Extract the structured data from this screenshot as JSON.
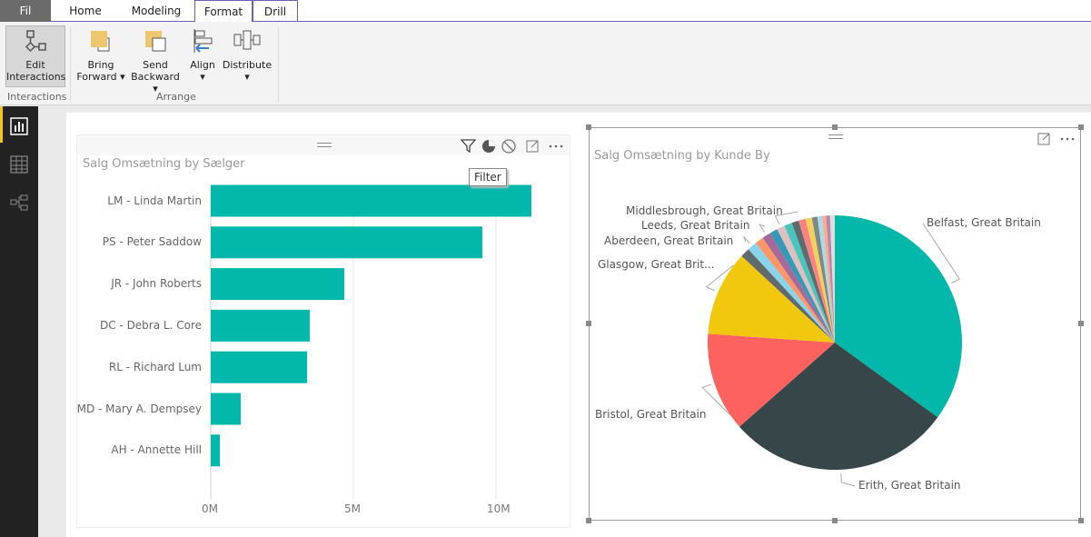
{
  "tabs": [
    {
      "label": "Fil"
    },
    {
      "label": "Home"
    },
    {
      "label": "Modeling"
    },
    {
      "label": "Format",
      "active": true
    },
    {
      "label": "Drill"
    }
  ],
  "ribbon": {
    "edit_interactions": {
      "line1": "Edit",
      "line2": "Interactions"
    },
    "bring_forward": {
      "line1": "Bring",
      "line2": "Forward"
    },
    "send_backward": {
      "line1": "Send",
      "line2": "Backward"
    },
    "align": {
      "line1": "Align"
    },
    "distribute": {
      "line1": "Distribute"
    },
    "groups": {
      "interactions": "Interactions",
      "arrange": "Arrange"
    }
  },
  "tooltip": "Filter",
  "bar_visual": {
    "title": "Salg Omsætning by Sælger"
  },
  "pie_visual": {
    "title": "Salg Omsætning by Kunde By"
  },
  "chart_data": [
    {
      "type": "bar",
      "orientation": "horizontal",
      "title": "Salg Omsætning by Sælger",
      "categories": [
        "LM - Linda Martin",
        "PS - Peter Saddow",
        "JR - John Roberts",
        "DC - Debra L. Core",
        "RL - Richard Lum",
        "MD - Mary A. Dempsey",
        "AH - Annette Hill"
      ],
      "values": [
        11.24,
        9.52,
        4.68,
        3.47,
        3.38,
        1.05,
        0.32
      ],
      "unit": "M",
      "xticks": [
        "0M",
        "5M",
        "10M"
      ],
      "xlim": [
        0,
        12
      ],
      "grid": true,
      "color": "#01B8AA"
    },
    {
      "type": "pie",
      "title": "Salg Omsætning by Kunde By",
      "slices": [
        {
          "label": "Belfast, Great Britain",
          "value": 35.0,
          "color": "#01B8AA"
        },
        {
          "label": "Erith, Great Britain",
          "value": 28.5,
          "color": "#374649"
        },
        {
          "label": "Bristol, Great Britain",
          "value": 12.6,
          "color": "#FD625E"
        },
        {
          "label": "Glasgow, Great Brit...",
          "value": 10.8,
          "color": "#F2C80F"
        },
        {
          "label": "",
          "value": 1.2,
          "color": "#5F6B6D"
        },
        {
          "label": "Aberdeen, Great Britain",
          "value": 1.2,
          "color": "#8AD4EB"
        },
        {
          "label": "",
          "value": 1.1,
          "color": "#FE9666"
        },
        {
          "label": "Leeds, Great Britain",
          "value": 1.1,
          "color": "#A66999"
        },
        {
          "label": "",
          "value": 1.0,
          "color": "#3599B8"
        },
        {
          "label": "Middlesbrough, Great Britain",
          "value": 1.0,
          "color": "#DFBFBF"
        },
        {
          "label": "",
          "value": 1.0,
          "color": "#4AC5BB"
        },
        {
          "label": "",
          "value": 0.9,
          "color": "#5F6B6D"
        },
        {
          "label": "",
          "value": 0.9,
          "color": "#FB8281"
        },
        {
          "label": "",
          "value": 0.8,
          "color": "#F4D25A"
        },
        {
          "label": "",
          "value": 0.7,
          "color": "#7F898A"
        },
        {
          "label": "",
          "value": 0.6,
          "color": "#A4DDEE"
        },
        {
          "label": "",
          "value": 0.5,
          "color": "#FDAB89"
        },
        {
          "label": "",
          "value": 0.5,
          "color": "#B687AC"
        },
        {
          "label": "",
          "value": 0.6,
          "color": "#DDDDDD"
        }
      ]
    }
  ]
}
